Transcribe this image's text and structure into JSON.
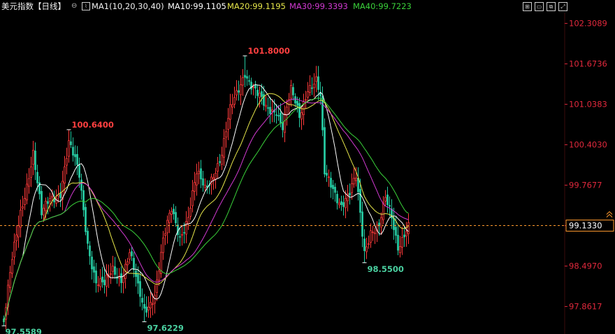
{
  "header": {
    "title": "美元指数【日线】",
    "ma_settings": "MA1(10,20,30,40)",
    "ma10": "MA10:99.1105",
    "ma20": "MA20:99.1195",
    "ma30": "MA30:99.3393",
    "ma40": "MA40:99.7223"
  },
  "colors": {
    "up": "#ff3a3a",
    "down": "#26c8a0",
    "ma10": "#ffffff",
    "ma20": "#e6e64a",
    "ma30": "#d23ad2",
    "ma40": "#3ad23a",
    "axis_text": "#e0283c",
    "price_line": "#ff9a2e"
  },
  "chart_data": {
    "type": "candlestick",
    "title": "美元指数【日线】",
    "y_ticks": [
      102.3089,
      101.6736,
      101.0383,
      100.403,
      99.7677,
      99.1323,
      98.497,
      97.8617
    ],
    "y_tick_labels": [
      "102.3089",
      "101.6736",
      "101.0383",
      "100.4030",
      "99.7677",
      "99.1323",
      "98.4970",
      "97.8617"
    ],
    "ylim": [
      97.43,
      102.48
    ],
    "current_price": 99.133,
    "current_price_label": "99.1330",
    "annotations": [
      {
        "label": "97.5589",
        "value": 97.5589,
        "kind": "low",
        "index": 0
      },
      {
        "label": "100.6400",
        "value": 100.64,
        "kind": "high",
        "index": 31
      },
      {
        "label": "97.6229",
        "value": 97.6229,
        "kind": "low",
        "index": 67
      },
      {
        "label": "101.8000",
        "value": 101.8,
        "kind": "high",
        "index": 115
      },
      {
        "label": "98.5500",
        "value": 98.55,
        "kind": "low",
        "index": 172
      }
    ],
    "ma_lines": [
      {
        "name": "MA10",
        "value": 99.1105
      },
      {
        "name": "MA20",
        "value": 99.1195
      },
      {
        "name": "MA30",
        "value": 99.3393
      },
      {
        "name": "MA40",
        "value": 99.7223
      }
    ],
    "close_anchors": [
      [
        0,
        97.62
      ],
      [
        4,
        98.55
      ],
      [
        8,
        99.35
      ],
      [
        14,
        100.3
      ],
      [
        18,
        99.25
      ],
      [
        22,
        99.55
      ],
      [
        27,
        99.7
      ],
      [
        31,
        100.4
      ],
      [
        36,
        99.9
      ],
      [
        40,
        98.9
      ],
      [
        44,
        98.25
      ],
      [
        48,
        98.15
      ],
      [
        52,
        98.45
      ],
      [
        56,
        98.35
      ],
      [
        60,
        98.7
      ],
      [
        64,
        98.1
      ],
      [
        67,
        97.8
      ],
      [
        72,
        98.1
      ],
      [
        76,
        98.85
      ],
      [
        80,
        99.35
      ],
      [
        84,
        99.0
      ],
      [
        88,
        99.3
      ],
      [
        92,
        99.9
      ],
      [
        96,
        99.7
      ],
      [
        100,
        100.0
      ],
      [
        104,
        100.25
      ],
      [
        108,
        100.9
      ],
      [
        112,
        101.3
      ],
      [
        115,
        101.6
      ],
      [
        118,
        101.35
      ],
      [
        121,
        101.15
      ],
      [
        125,
        100.95
      ],
      [
        130,
        101.0
      ],
      [
        133,
        100.7
      ],
      [
        137,
        101.2
      ],
      [
        141,
        100.85
      ],
      [
        145,
        101.35
      ],
      [
        149,
        101.4
      ],
      [
        151,
        101.1
      ],
      [
        153,
        99.9
      ],
      [
        157,
        99.75
      ],
      [
        161,
        99.5
      ],
      [
        165,
        99.6
      ],
      [
        168,
        99.85
      ],
      [
        170,
        99.3
      ],
      [
        172,
        98.75
      ],
      [
        175,
        99.1
      ],
      [
        179,
        99.1
      ],
      [
        182,
        99.5
      ],
      [
        185,
        99.25
      ],
      [
        188,
        98.85
      ],
      [
        191,
        99.05
      ],
      [
        193,
        99.13
      ]
    ]
  }
}
